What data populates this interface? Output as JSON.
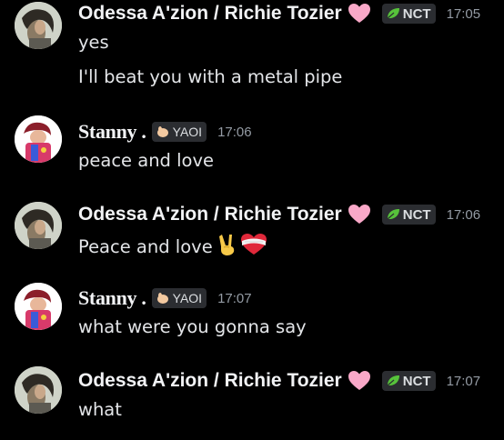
{
  "messages": [
    {
      "author": "Odessa A'zion / Richie Tozier",
      "tag": "NCT",
      "time": "17:05",
      "lines": [
        "yes",
        "I'll beat you with a metal pipe"
      ]
    },
    {
      "author": "Stanny .",
      "tag": "YAOI",
      "time": "17:06",
      "lines": [
        "peace and love"
      ]
    },
    {
      "author": "Odessa A'zion / Richie Tozier",
      "tag": "NCT",
      "time": "17:06",
      "lines": [
        "Peace and love"
      ]
    },
    {
      "author": "Stanny .",
      "tag": "YAOI",
      "time": "17:07",
      "lines": [
        "what were you gonna say"
      ]
    },
    {
      "author": "Odessa A'zion / Richie Tozier",
      "tag": "NCT",
      "time": "17:07",
      "lines": [
        "what"
      ]
    }
  ],
  "icons": {
    "author_decoration": "pink-heart-icon",
    "nct_tag": "leaf-icon",
    "yaoi_tag": "hand-icon",
    "message_emojis": [
      "victory-hand-icon",
      "bandaged-heart-icon"
    ]
  },
  "colors": {
    "background": "#000000",
    "username": "#f2f3f5",
    "message_text": "#e3e5e8",
    "timestamp": "#949ba4",
    "tag_background": "#2b2d31",
    "leaf": "#57c33b",
    "heart": "#f9a8c8"
  }
}
